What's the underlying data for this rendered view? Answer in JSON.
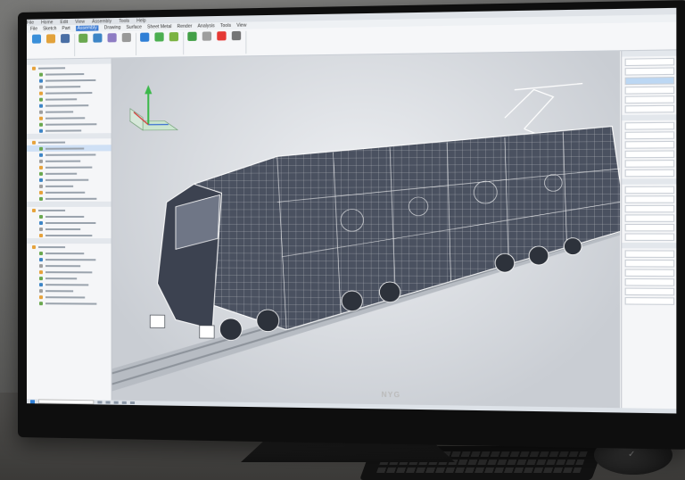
{
  "app": {
    "title_items": [
      "File",
      "Home",
      "Edit",
      "View",
      "Assembly",
      "Tools",
      "Help"
    ],
    "window_title": ""
  },
  "menubar": {
    "tabs": [
      "File",
      "Sketch",
      "Part",
      "Assembly",
      "Drawing",
      "Surface",
      "Sheet Metal",
      "Render",
      "Analysis",
      "Tools",
      "View"
    ],
    "active_index": 3
  },
  "ribbon": {
    "groups": [
      {
        "buttons": [
          {
            "label": "",
            "icon": "new-icon",
            "color": "#3a8fd9"
          },
          {
            "label": "",
            "icon": "open-icon",
            "color": "#e2a23b"
          },
          {
            "label": "",
            "icon": "save-icon",
            "color": "#4a6fa5"
          }
        ]
      },
      {
        "buttons": [
          {
            "label": "",
            "icon": "sketch-icon",
            "color": "#6aa84f"
          },
          {
            "label": "",
            "icon": "extrude-icon",
            "color": "#3d85c6"
          },
          {
            "label": "",
            "icon": "revolve-icon",
            "color": "#8e7cc3"
          },
          {
            "label": "",
            "icon": "fillet-icon",
            "color": "#999999"
          }
        ]
      },
      {
        "buttons": [
          {
            "label": "",
            "icon": "pointer-icon",
            "color": "#2f7fd6"
          },
          {
            "label": "",
            "icon": "move-icon",
            "color": "#4caf50"
          },
          {
            "label": "",
            "icon": "rotate-icon",
            "color": "#7cb342"
          }
        ]
      },
      {
        "buttons": [
          {
            "label": "",
            "icon": "measure-icon",
            "color": "#43a047"
          },
          {
            "label": "",
            "icon": "section-icon",
            "color": "#9e9e9e"
          },
          {
            "label": "",
            "icon": "render-icon",
            "color": "#e53935"
          },
          {
            "label": "",
            "icon": "settings-icon",
            "color": "#757575"
          }
        ]
      }
    ]
  },
  "left_panel": {
    "sections": [
      {
        "head": "",
        "items": [
          "",
          "",
          "",
          "",
          "",
          "",
          "",
          "",
          "",
          "",
          ""
        ]
      },
      {
        "head": "",
        "items": [
          "",
          "",
          "",
          "",
          "",
          "",
          "",
          "",
          "",
          ""
        ]
      },
      {
        "head": "",
        "items": [
          "",
          "",
          "",
          "",
          ""
        ]
      },
      {
        "head": "",
        "items": [
          "",
          "",
          "",
          "",
          "",
          "",
          "",
          "",
          "",
          ""
        ]
      }
    ]
  },
  "right_panel": {
    "rows": [
      "",
      "",
      "",
      "",
      "",
      "",
      "",
      "",
      "",
      "",
      "",
      "",
      "",
      "",
      "",
      "",
      "",
      "",
      "",
      "",
      "",
      "",
      "",
      ""
    ]
  },
  "monitor": {
    "brand": "NYG"
  },
  "taskbar": {
    "items": [
      "",
      "",
      "",
      "",
      ""
    ]
  },
  "colors": {
    "accent": "#3c7bd3",
    "viewport_bg": "#d7dbe0",
    "model_fill": "#4a5160",
    "wire": "#ffffff",
    "axis_x": "#d33b3b",
    "axis_y": "#3bb84a",
    "axis_z": "#3b6fd3"
  }
}
